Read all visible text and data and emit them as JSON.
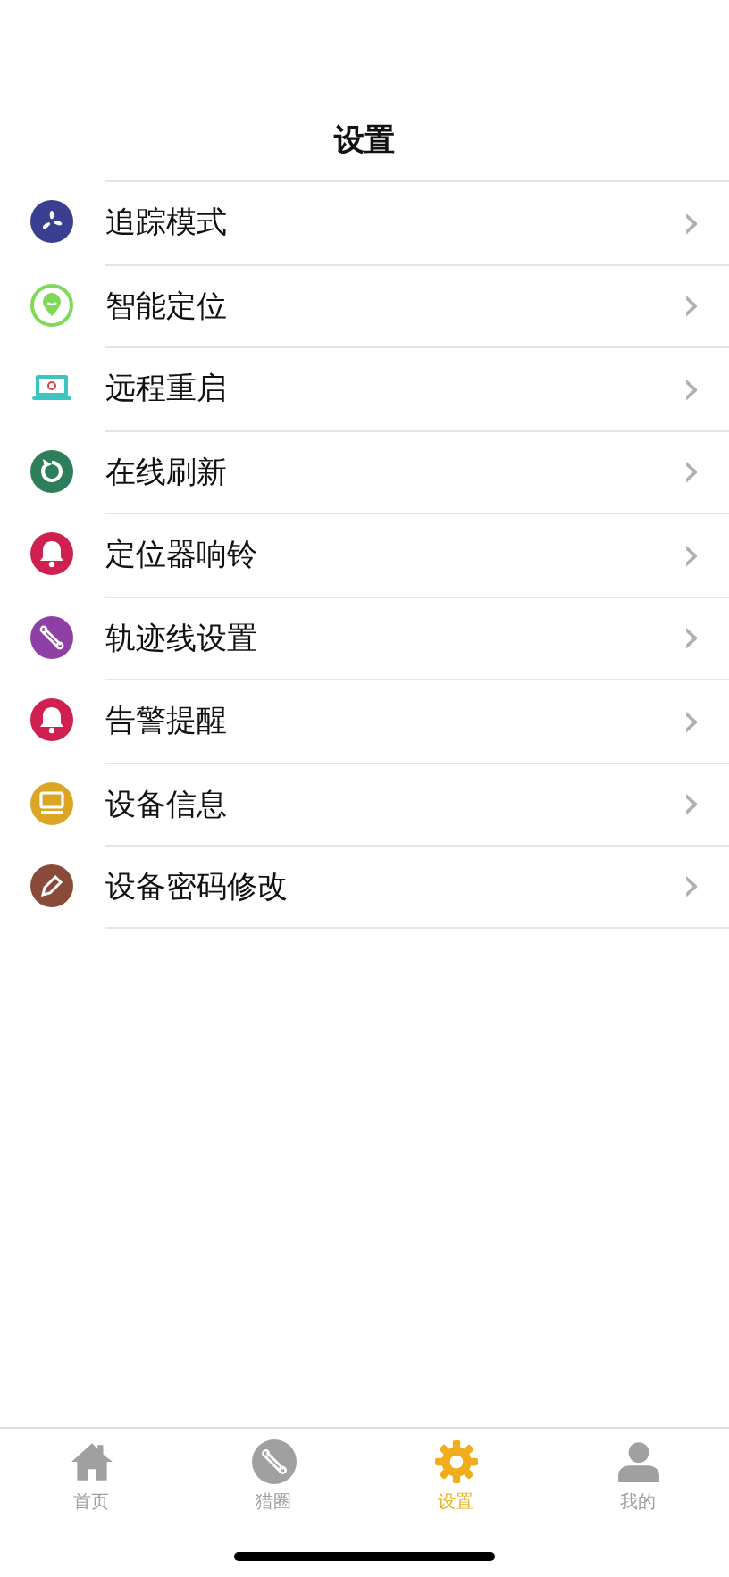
{
  "header": {
    "title": "设置"
  },
  "items": [
    {
      "label": "追踪模式",
      "kind": "fan",
      "color": "#3a3f8f",
      "chevron": "›"
    },
    {
      "label": "智能定位",
      "kind": "pin",
      "color": "#7ed957",
      "chevron": "›"
    },
    {
      "label": "远程重启",
      "kind": "laptop",
      "color": "#3cc4c0",
      "chevron": "›"
    },
    {
      "label": "在线刷新",
      "kind": "refresh",
      "color": "#2e7d5b",
      "chevron": "›"
    },
    {
      "label": "定位器响铃",
      "kind": "bell",
      "color": "#d0204f",
      "chevron": "›"
    },
    {
      "label": "轨迹线设置",
      "kind": "link",
      "color": "#8e3fa6",
      "chevron": "›"
    },
    {
      "label": "告警提醒",
      "kind": "bell",
      "color": "#d0204f",
      "chevron": "›"
    },
    {
      "label": "设备信息",
      "kind": "card",
      "color": "#dba526",
      "chevron": "›"
    },
    {
      "label": "设备密码修改",
      "kind": "pencil",
      "color": "#8a4a3a",
      "chevron": "›"
    }
  ],
  "tabs": [
    {
      "label": "首页",
      "kind": "home",
      "selected": false
    },
    {
      "label": "猎圈",
      "kind": "link",
      "selected": false
    },
    {
      "label": "设置",
      "kind": "gear",
      "selected": true
    },
    {
      "label": "我的",
      "kind": "person",
      "selected": false
    }
  ]
}
